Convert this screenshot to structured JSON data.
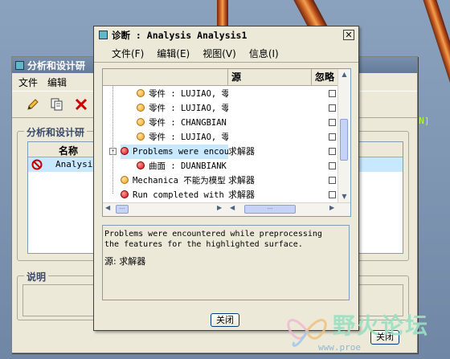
{
  "background": {
    "green_text_1": "h N]",
    "green_text_2": "]"
  },
  "back_window": {
    "title": "分析和设计研",
    "menu": [
      "文件",
      "编辑"
    ],
    "toolbar_icons": [
      "pencil-icon",
      "copy-icon",
      "delete-icon"
    ],
    "group_title": "分析和设计研",
    "table_header": "名称",
    "table_row": "Analysis",
    "description_label": "说明",
    "close_button": "关闭"
  },
  "dialog": {
    "title": "诊断 : Analysis Analysis1",
    "menu": [
      "文件(F)",
      "编辑(E)",
      "视图(V)",
      "信息(I)"
    ],
    "columns": {
      "source": "源",
      "ignore": "忽略"
    },
    "rows": [
      {
        "indent": 1,
        "dot": "orange",
        "text": "零件 : LUJIAO, 零",
        "source": ""
      },
      {
        "indent": 1,
        "dot": "orange",
        "text": "零件 : LUJIAO, 零",
        "source": ""
      },
      {
        "indent": 1,
        "dot": "orange",
        "text": "零件 : CHANGBIAN",
        "source": ""
      },
      {
        "indent": 1,
        "dot": "orange",
        "text": "零件 : LUJIAO, 零",
        "source": ""
      },
      {
        "indent": 0,
        "dot": "red",
        "text": "Problems were encou",
        "source": "求解器",
        "expanded": true,
        "selected": true
      },
      {
        "indent": 1,
        "dot": "red",
        "text": "曲面 : DUANBIANK",
        "source": ""
      },
      {
        "indent": 0,
        "dot": "orange",
        "text": "Mechanica 不能为模型",
        "source": "求解器"
      },
      {
        "indent": 0,
        "dot": "red",
        "text": "Run completed with",
        "source": "求解器"
      }
    ],
    "message": "Problems were encountered while preprocessing\nthe features for the highlighted surface.",
    "message_source": "源: 求解器",
    "close_button": "关闭"
  },
  "watermark": {
    "text": "野火论坛",
    "url": "www.proe"
  },
  "colors": {
    "selected_row": "#c8e8ff",
    "dialog_bg": "#ece9d8",
    "error_dot": "#d01010",
    "warning_dot": "#f0a020"
  }
}
